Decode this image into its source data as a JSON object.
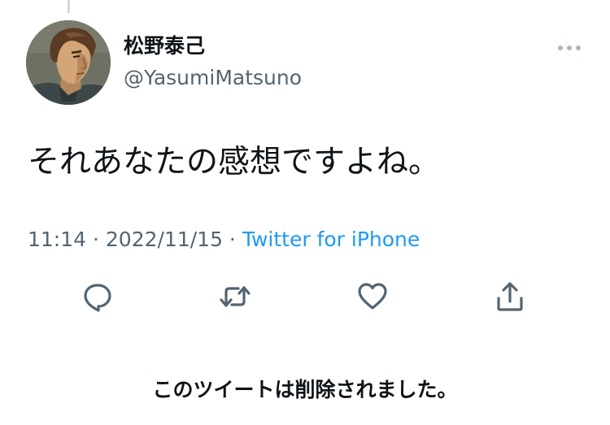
{
  "tweet": {
    "display_name": "松野泰己",
    "handle": "@YasumiMatsuno",
    "text": "それあなたの感想ですよね。",
    "time": "11:14",
    "date": "2022/11/15",
    "separator": " · ",
    "source": "Twitter for iPhone"
  },
  "icons": {
    "more": "more-horizontal-icon",
    "reply": "reply-icon",
    "retweet": "retweet-icon",
    "like": "heart-icon",
    "share": "share-icon"
  },
  "notice": {
    "deleted": "このツイートは削除されました。"
  },
  "colors": {
    "text": "#0f1419",
    "secondary_text": "#536471",
    "link": "#1d9bf0",
    "icon": "#536471",
    "more_dots": "#aab8c2"
  }
}
